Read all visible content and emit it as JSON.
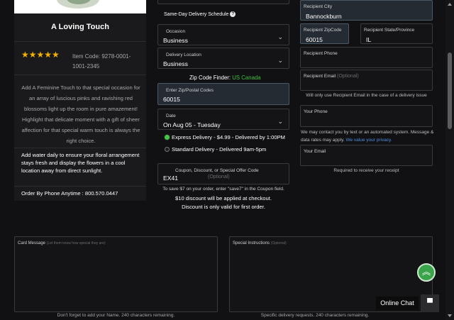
{
  "product": {
    "title": "A Loving Touch",
    "stars": "★★★★★",
    "rating": 5,
    "item_code": "Item Code: 9278-0001-1001-2345",
    "description": "Add A Feminine Touch to that special occasion for an array of luscious pinks and ravishing red blossoms light up the room in pure amazement! Highlight that delicate moment with a gift of sheer affection for that special warm touch is always the right choice.",
    "care": "Add water daily to ensure your floral arrangement stays fresh and display the flowers in a cool location away from direct sunlight.",
    "phone_order": "Order By Phone Anytime : 800.570.0447"
  },
  "delivery": {
    "same_day_label": "Same-Day Delivery Schedule",
    "occasion": {
      "label": "Occasion",
      "value": "Business"
    },
    "location": {
      "label": "Delivery Location",
      "value": "Business"
    },
    "zip_finder": {
      "label": "Zip Code Finder:",
      "us": "US",
      "canada": "Canada"
    },
    "zip": {
      "label": "Enter Zip/Postal Codes",
      "value": "60015"
    },
    "date": {
      "label": "Date",
      "value": "On Aug 05 - Tuesday"
    },
    "options": [
      {
        "label": "Express Delivery - $4.99 - Delivered by 1:00PM",
        "selected": true
      },
      {
        "label": "Standard Delivery - Delivered 9am-5pm",
        "selected": false
      }
    ],
    "coupon": {
      "label": "Coupon, Discount, or Special Offer Code",
      "optional": "(Optional)",
      "value": "EX41"
    },
    "coupon_hint": "To save $7 on your order, enter \"save7\" in the Coupon field.",
    "discount_line1": "$10 discount will be applied at checkout.",
    "discount_line2": "Discount is only valid for first order."
  },
  "recipient": {
    "city": {
      "label": "Recipient City",
      "value": "Bannockburn"
    },
    "zip": {
      "label": "Recipient ZipCode",
      "value": "60015"
    },
    "state": {
      "label": "Recipient State/Province",
      "value": "IL"
    },
    "phone": {
      "label": "Recipient Phone",
      "value": ""
    },
    "email": {
      "label": "Recipient Email",
      "optional": "(Optional)",
      "value": ""
    },
    "email_hint": "Will only use Recipient Email in the case of a delivery issue",
    "your_phone": {
      "label": "Your Phone",
      "value": ""
    },
    "contact_hint": "We may contact you by text or an automated system. Message & data rates may apply.",
    "privacy_link": "We value your privacy.",
    "your_email": {
      "label": "Your Email",
      "value": ""
    },
    "your_email_hint": "Required to receive your receipt"
  },
  "card": {
    "label": "Card Message",
    "sub": "(Let them know how special they are)",
    "hint": "Don't forget to add your Name. 240 characters remaining."
  },
  "instructions": {
    "label": "Special Instructions",
    "sub": "(Optional)",
    "hint": "Specific delivery requests. 240 characters remaining."
  },
  "chat": {
    "label": "Online Chat"
  },
  "colors": {
    "accent_green": "#3fbf3f",
    "link_blue": "#4d8fdf",
    "star": "#f2b100",
    "scroll_top_btn": "#3aa44a"
  },
  "icons": [
    "info-icon",
    "chevron-down-icon",
    "chevrons-up-icon",
    "chat-bubble-icon"
  ]
}
